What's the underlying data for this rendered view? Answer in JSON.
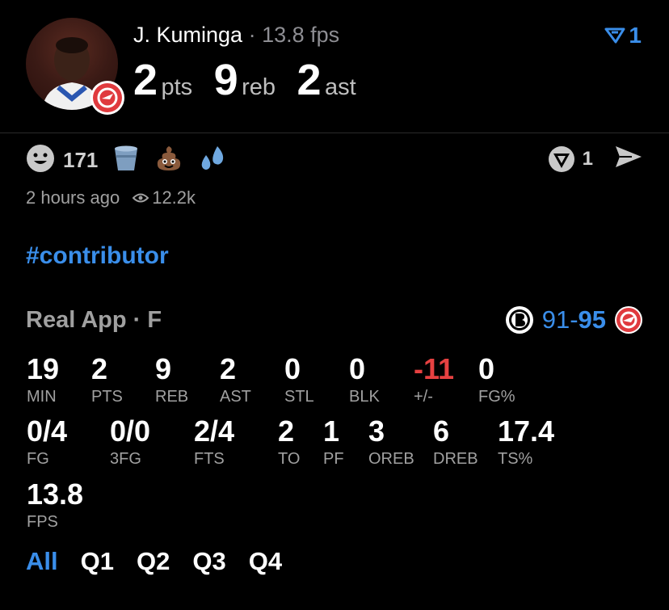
{
  "header": {
    "player_name": "J. Kuminga",
    "separator": " · ",
    "fps_text": "13.8 fps",
    "pts_value": "2",
    "pts_label": "pts",
    "reb_value": "9",
    "reb_label": "reb",
    "ast_value": "2",
    "ast_label": "ast",
    "filter_count": "1"
  },
  "reactions": {
    "smile_count": "171",
    "right_count": "1"
  },
  "meta": {
    "time": "2 hours ago",
    "views": "12.2k"
  },
  "tag": "#contributor",
  "game": {
    "source": "Real App · F",
    "away_score": "91",
    "dash": "-",
    "home_score": "95"
  },
  "stats_row1": [
    {
      "value": "19",
      "label": "MIN"
    },
    {
      "value": "2",
      "label": "PTS"
    },
    {
      "value": "9",
      "label": "REB"
    },
    {
      "value": "2",
      "label": "AST"
    },
    {
      "value": "0",
      "label": "STL"
    },
    {
      "value": "0",
      "label": "BLK"
    },
    {
      "value": "-11",
      "label": "+/-"
    },
    {
      "value": "0",
      "label": "FG%"
    }
  ],
  "stats_row2": [
    {
      "value": "0/4",
      "label": "FG"
    },
    {
      "value": "0/0",
      "label": "3FG"
    },
    {
      "value": "2/4",
      "label": "FTS"
    },
    {
      "value": "2",
      "label": "TO"
    },
    {
      "value": "1",
      "label": "PF"
    },
    {
      "value": "3",
      "label": "OREB"
    },
    {
      "value": "6",
      "label": "DREB"
    },
    {
      "value": "17.4",
      "label": "TS%"
    }
  ],
  "stats_row3": [
    {
      "value": "13.8",
      "label": "FPS"
    }
  ],
  "quarters": [
    "All",
    "Q1",
    "Q2",
    "Q3",
    "Q4"
  ],
  "colors": {
    "accent": "#3a8eea",
    "negative": "#e64141",
    "hawks_red": "#e03a3e"
  },
  "icons": [
    "smile-icon",
    "bucket-icon",
    "poop-emoji-icon",
    "sweat-drops-icon",
    "filter-icon",
    "vault-icon",
    "share-icon",
    "eye-icon",
    "nets-logo-icon",
    "hawks-logo-icon"
  ]
}
